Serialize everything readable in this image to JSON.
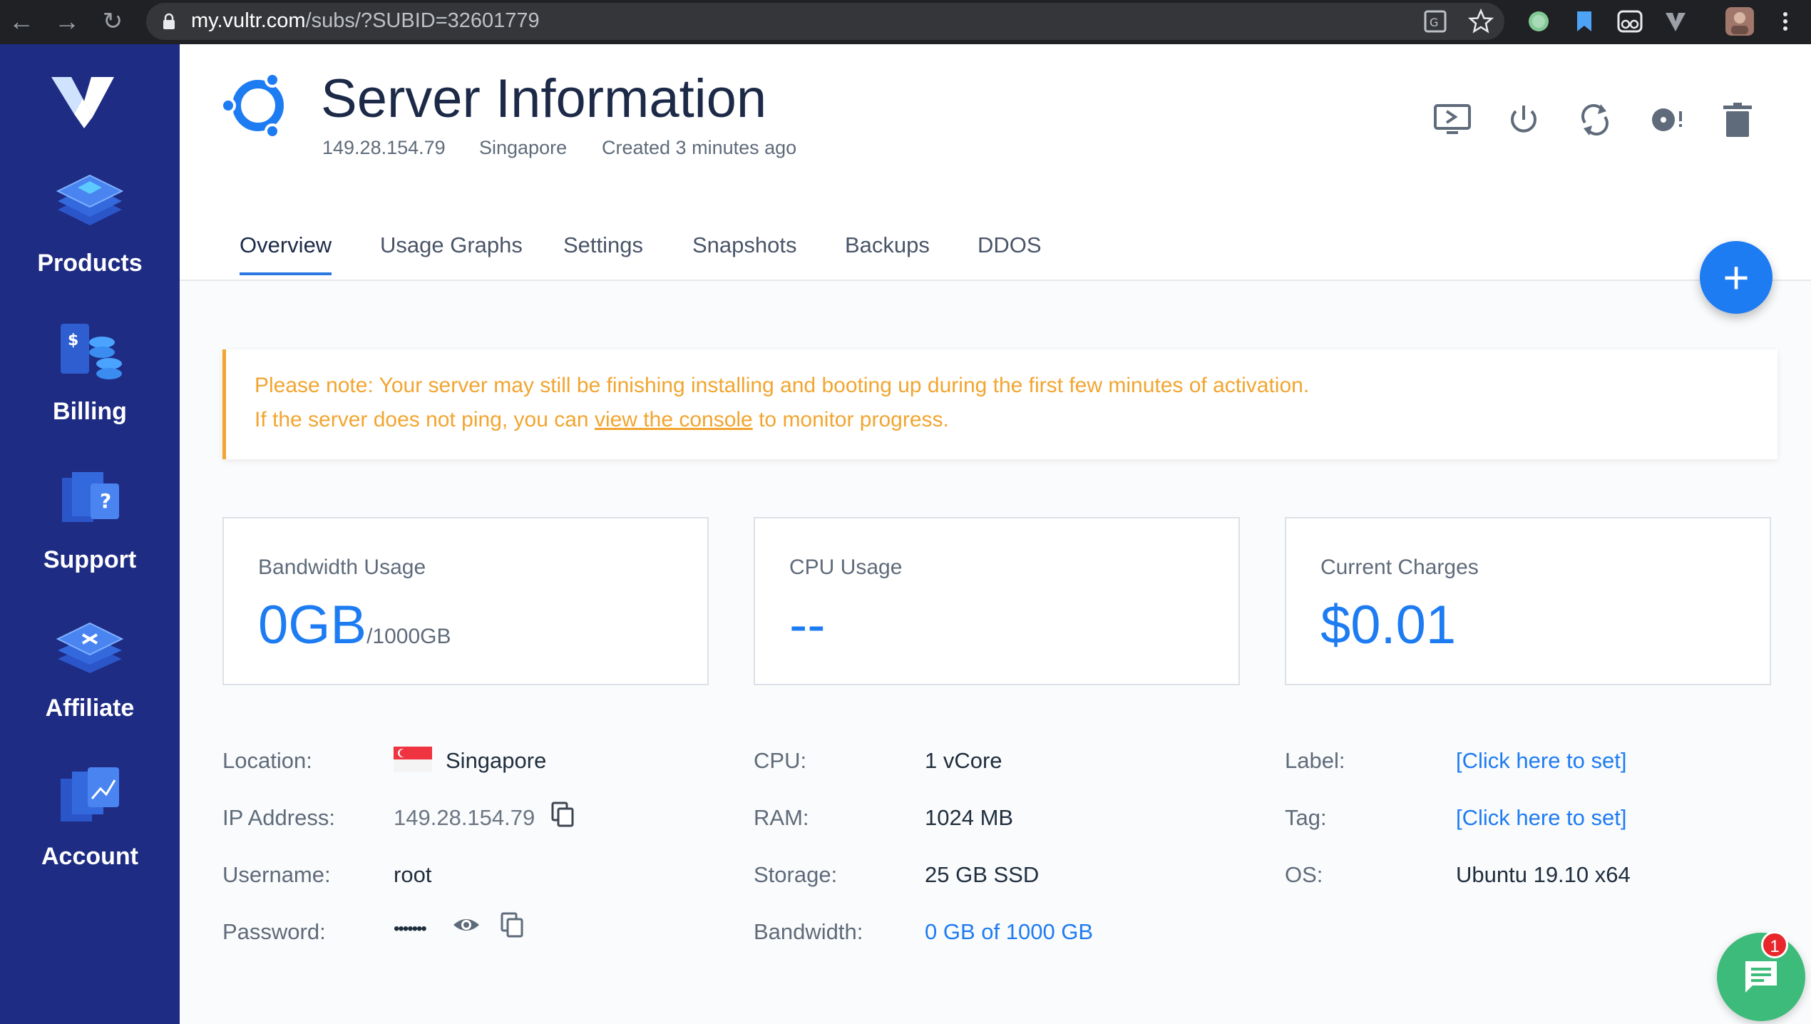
{
  "browser": {
    "url_host": "my.vultr.com",
    "url_path": "/subs/?SUBID=32601779"
  },
  "sidebar": {
    "items": [
      {
        "label": "Products",
        "icon": "products-icon"
      },
      {
        "label": "Billing",
        "icon": "billing-icon"
      },
      {
        "label": "Support",
        "icon": "support-icon"
      },
      {
        "label": "Affiliate",
        "icon": "affiliate-icon"
      },
      {
        "label": "Account",
        "icon": "account-icon"
      }
    ]
  },
  "header": {
    "title": "Server Information",
    "ip": "149.28.154.79",
    "location": "Singapore",
    "created": "Created 3 minutes ago",
    "actions": [
      "console-icon",
      "power-icon",
      "restart-icon",
      "reinstall-icon",
      "trash-icon"
    ]
  },
  "tabs": [
    {
      "label": "Overview",
      "active": true
    },
    {
      "label": "Usage Graphs"
    },
    {
      "label": "Settings"
    },
    {
      "label": "Snapshots"
    },
    {
      "label": "Backups"
    },
    {
      "label": "DDOS"
    }
  ],
  "fab": {
    "label": "+"
  },
  "notice": {
    "line1": "Please note: Your server may still be finishing installing and booting up during the first few minutes of activation.",
    "line2_before": "If the server does not ping, you can ",
    "line2_link": "view the console",
    "line2_after": " to monitor progress."
  },
  "cards": {
    "bandwidth": {
      "label": "Bandwidth Usage",
      "value": "0GB",
      "unit": "/1000GB"
    },
    "cpu": {
      "label": "CPU Usage",
      "value": "--"
    },
    "charges": {
      "label": "Current Charges",
      "value": "$0.01"
    }
  },
  "details": {
    "location_label": "Location:",
    "location_value": "Singapore",
    "ip_label": "IP Address:",
    "ip_value": "149.28.154.79",
    "username_label": "Username:",
    "username_value": "root",
    "password_label": "Password:",
    "password_value": "•••••••",
    "cpu_label": "CPU:",
    "cpu_value": "1 vCore",
    "ram_label": "RAM:",
    "ram_value": "1024 MB",
    "storage_label": "Storage:",
    "storage_value": "25 GB SSD",
    "bandwidth_label": "Bandwidth:",
    "bandwidth_value": "0 GB of 1000 GB",
    "label_label": "Label:",
    "label_value": "[Click here to set]",
    "tag_label": "Tag:",
    "tag_value": "[Click here to set]",
    "os_label": "OS:",
    "os_value": "Ubuntu 19.10 x64"
  },
  "chat": {
    "badge": "1"
  },
  "colors": {
    "sidebar": "#1e2c83",
    "accent": "#1e7cf2",
    "warning": "#f2a530",
    "chat": "#3dbb7a"
  }
}
